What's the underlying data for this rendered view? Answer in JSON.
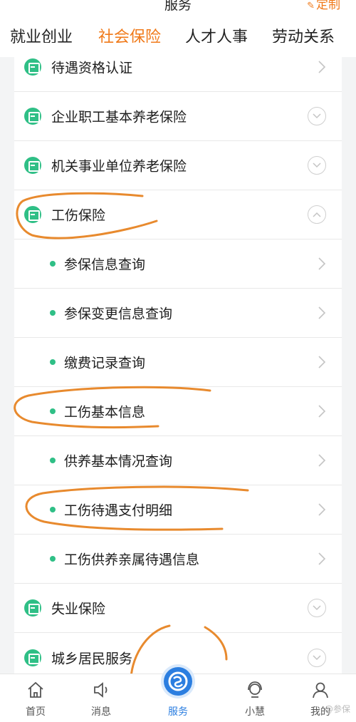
{
  "header": {
    "title": "服务",
    "customize_label": "定制",
    "tabs": [
      {
        "label": "就业创业",
        "active": false
      },
      {
        "label": "社会保险",
        "active": true
      },
      {
        "label": "人才人事",
        "active": false
      },
      {
        "label": "劳动关系",
        "active": false
      }
    ]
  },
  "list": {
    "rows": [
      {
        "label": "待遇资格认证",
        "kind": "category",
        "control": "chevron"
      },
      {
        "label": "企业职工基本养老保险",
        "kind": "category",
        "control": "expand"
      },
      {
        "label": "机关事业单位养老保险",
        "kind": "category",
        "control": "expand"
      },
      {
        "label": "工伤保险",
        "kind": "category",
        "control": "collapse"
      },
      {
        "label": "参保信息查询",
        "kind": "sub",
        "control": "chevron"
      },
      {
        "label": "参保变更信息查询",
        "kind": "sub",
        "control": "chevron"
      },
      {
        "label": "缴费记录查询",
        "kind": "sub",
        "control": "chevron"
      },
      {
        "label": "工伤基本信息",
        "kind": "sub",
        "control": "chevron"
      },
      {
        "label": "供养基本情况查询",
        "kind": "sub",
        "control": "chevron"
      },
      {
        "label": "工伤待遇支付明细",
        "kind": "sub",
        "control": "chevron"
      },
      {
        "label": "工伤供养亲属待遇信息",
        "kind": "sub",
        "control": "chevron"
      },
      {
        "label": "失业保险",
        "kind": "category",
        "control": "expand"
      },
      {
        "label": "城乡居民服务",
        "kind": "category",
        "control": "expand"
      }
    ]
  },
  "bottom_nav": {
    "items": [
      {
        "label": "首页",
        "icon": "home-icon"
      },
      {
        "label": "消息",
        "icon": "speaker-icon"
      },
      {
        "label": "服务",
        "icon": "service-logo-icon",
        "active": true
      },
      {
        "label": "小慧",
        "icon": "headset-icon"
      },
      {
        "label": "我的",
        "icon": "user-icon"
      }
    ],
    "watermark": "@参保"
  },
  "colors": {
    "accent_orange": "#f07a1a",
    "icon_green": "#2fbf86",
    "active_blue": "#2b7ee0"
  }
}
